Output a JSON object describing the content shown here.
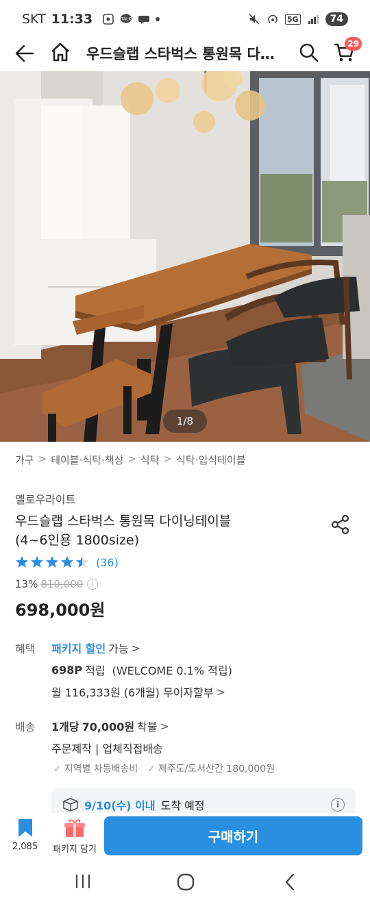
{
  "status": {
    "carrier": "SKT",
    "time": "11:33",
    "battery": "74",
    "network": "5G"
  },
  "header": {
    "title": "우드슬랩 스타벅스 통원목 다이닝테이블 (4~6인용 1800size)",
    "cart_count": "29"
  },
  "image": {
    "counter": "1/8"
  },
  "breadcrumb": [
    "가구",
    "테이블·식탁·책상",
    "식탁",
    "식탁·입식테이블"
  ],
  "product": {
    "brand": "옐로우라이트",
    "name_line1": "우드슬랩 스타벅스 통원목 다이닝테이블",
    "name_line2": "(4~6인용 1800size)",
    "rating": 4.5,
    "review_count": "(36)",
    "discount": "13%",
    "original_price": "810,000",
    "price": "698,000원"
  },
  "benefits": {
    "label": "혜택",
    "package_discount": "패키지 할인",
    "package_available": "가능",
    "points_value": "698P",
    "points_text": "적립",
    "points_welcome": "(WELCOME 0.1% 적립)",
    "installment": "월 116,333원 (6개월) 무이자할부"
  },
  "shipping": {
    "label": "배송",
    "per_unit": "1개당",
    "fee": "70,000원",
    "fee_type": "착불",
    "method": "주문제작 | 업체직접배송",
    "note1": "지역별 차등배송비",
    "note2": "제주도/도서산간 180,000원",
    "arrival_date": "9/10(수) 이내",
    "arrival_text": "도착 예정"
  },
  "bottom": {
    "bookmark_count": "2,085",
    "package_label": "패키지 담기",
    "buy_label": "구매하기"
  },
  "colors": {
    "accent": "#2a8fe0",
    "badge": "#ff5a5a"
  }
}
